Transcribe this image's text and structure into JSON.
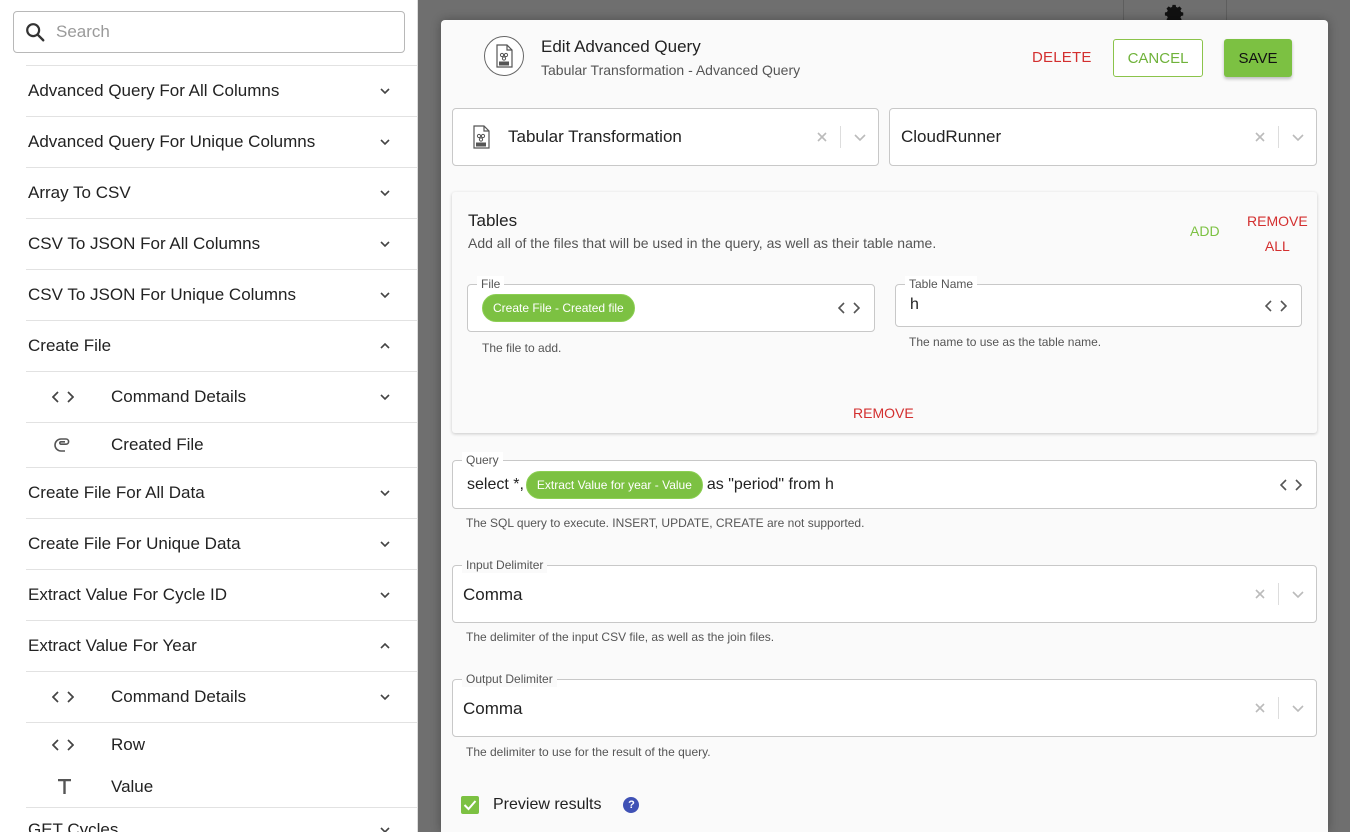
{
  "search": {
    "placeholder": "Search"
  },
  "sidebar": {
    "items": [
      {
        "label": "Advanced Query For All Columns",
        "expanded": false
      },
      {
        "label": "Advanced Query For Unique Columns",
        "expanded": false
      },
      {
        "label": "Array To CSV",
        "expanded": false
      },
      {
        "label": "CSV To JSON For All Columns",
        "expanded": false
      },
      {
        "label": "CSV To JSON For Unique Columns",
        "expanded": false
      },
      {
        "label": "Create File",
        "expanded": true
      },
      {
        "label": "Create File For All Data",
        "expanded": false
      },
      {
        "label": "Create File For Unique Data",
        "expanded": false
      },
      {
        "label": "Extract Value For Cycle ID",
        "expanded": false
      },
      {
        "label": "Extract Value For Year",
        "expanded": true
      },
      {
        "label": "GET Cycles",
        "expanded": false
      }
    ],
    "create_file_children": [
      {
        "label": "Command Details",
        "icon": "code-icon"
      },
      {
        "label": "Created File",
        "icon": "paperclip-icon"
      }
    ],
    "extract_year_children": [
      {
        "label": "Command Details",
        "icon": "code-icon"
      },
      {
        "label": "Row",
        "icon": "code-icon"
      },
      {
        "label": "Value",
        "icon": "text-icon"
      }
    ]
  },
  "modal": {
    "title": "Edit Advanced Query",
    "subtitle": "Tabular Transformation - Advanced Query",
    "delete_label": "DELETE",
    "cancel_label": "CANCEL",
    "save_label": "SAVE",
    "connector_select": "Tabular Transformation",
    "runner_select": "CloudRunner",
    "tables": {
      "title": "Tables",
      "description": "Add all of the files that will be used in the query, as well as their table name.",
      "add_label": "ADD",
      "remove_all_line1": "REMOVE",
      "remove_all_line2": "ALL",
      "file_legend": "File",
      "file_chip": "Create File - Created file",
      "file_helper": "The file to add.",
      "table_name_legend": "Table Name",
      "table_name_value": "h",
      "table_name_helper": "The name to use as the table name.",
      "remove_label": "REMOVE"
    },
    "query": {
      "legend": "Query",
      "prefix": "select *,",
      "chip": "Extract Value for year - Value",
      "suffix": "as \"period\" from h",
      "helper": "The SQL query to execute. INSERT, UPDATE, CREATE are not supported."
    },
    "input_delimiter": {
      "legend": "Input Delimiter",
      "value": "Comma",
      "helper": "The delimiter of the input CSV file, as well as the join files."
    },
    "output_delimiter": {
      "legend": "Output Delimiter",
      "value": "Comma",
      "helper": "The delimiter to use for the result of the query."
    },
    "preview": {
      "label": "Preview results",
      "checked": true,
      "help": "?"
    }
  },
  "colors": {
    "accent_green": "#7cc142",
    "danger_red": "#d32f2f",
    "help_blue": "#3f51b5"
  }
}
